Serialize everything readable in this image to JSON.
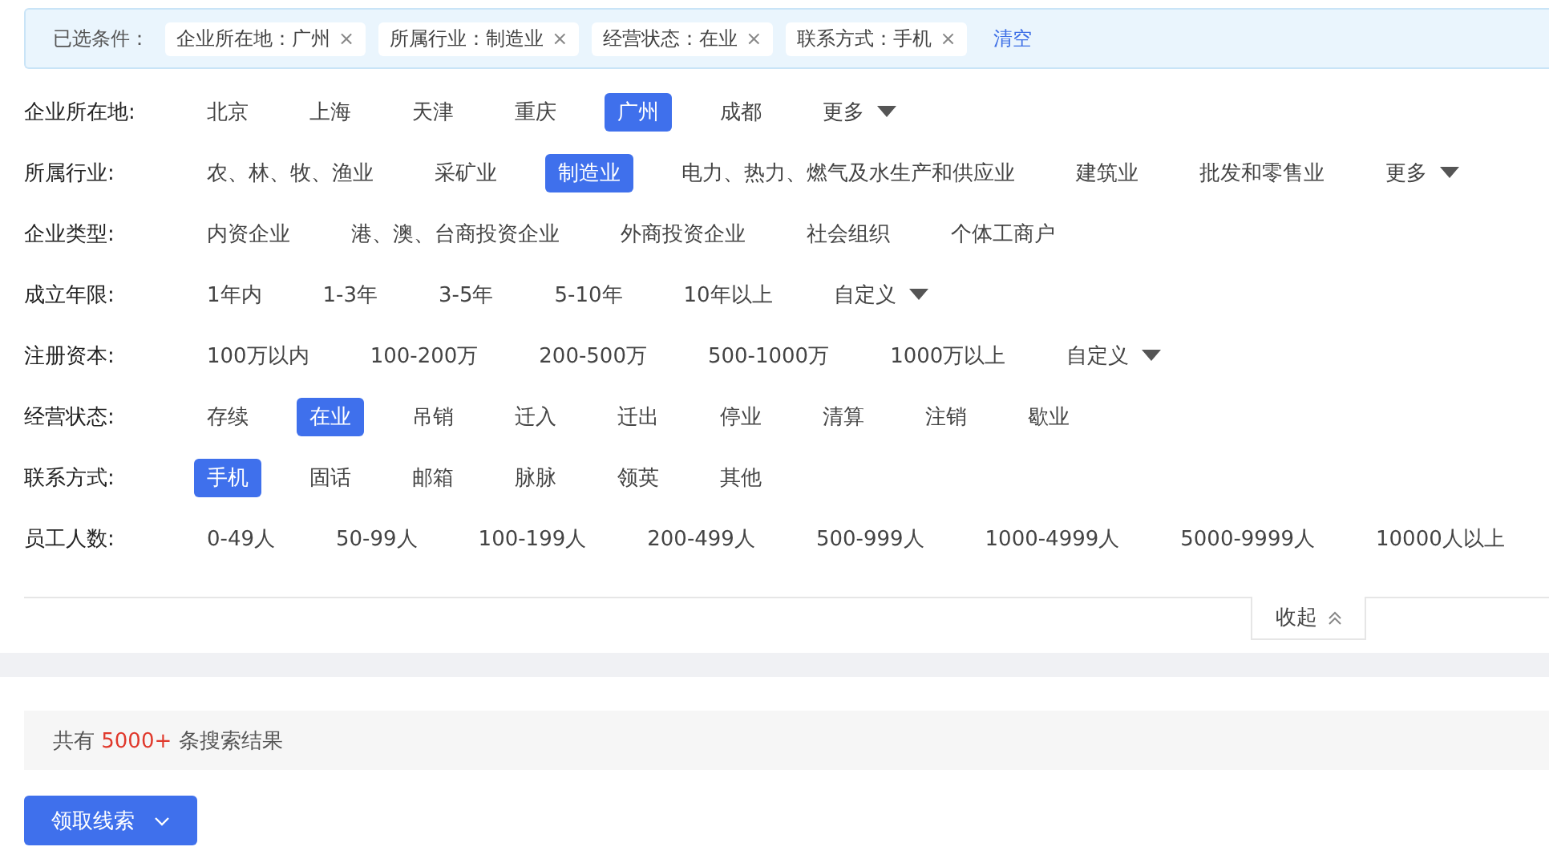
{
  "selected_conditions": {
    "label": "已选条件：",
    "tags": [
      {
        "text": "企业所在地：广州",
        "close": "×"
      },
      {
        "text": "所属行业：制造业",
        "close": "×"
      },
      {
        "text": "经营状态：在业",
        "close": "×"
      },
      {
        "text": "联系方式：手机",
        "close": "×"
      }
    ],
    "clear": "清空"
  },
  "filters": [
    {
      "label": "企业所在地:",
      "options": [
        {
          "kind": "option",
          "text": "北京",
          "selected": false
        },
        {
          "kind": "option",
          "text": "上海",
          "selected": false
        },
        {
          "kind": "option",
          "text": "天津",
          "selected": false
        },
        {
          "kind": "option",
          "text": "重庆",
          "selected": false
        },
        {
          "kind": "option",
          "text": "广州",
          "selected": true
        },
        {
          "kind": "option",
          "text": "成都",
          "selected": false
        },
        {
          "kind": "dropdown",
          "text": "更多",
          "selected": false
        }
      ]
    },
    {
      "label": "所属行业:",
      "options": [
        {
          "kind": "option",
          "text": "农、林、牧、渔业",
          "selected": false
        },
        {
          "kind": "option",
          "text": "采矿业",
          "selected": false
        },
        {
          "kind": "option",
          "text": "制造业",
          "selected": true
        },
        {
          "kind": "option",
          "text": "电力、热力、燃气及水生产和供应业",
          "selected": false
        },
        {
          "kind": "option",
          "text": "建筑业",
          "selected": false
        },
        {
          "kind": "option",
          "text": "批发和零售业",
          "selected": false
        },
        {
          "kind": "dropdown",
          "text": "更多",
          "selected": false
        }
      ]
    },
    {
      "label": "企业类型:",
      "options": [
        {
          "kind": "option",
          "text": "内资企业",
          "selected": false
        },
        {
          "kind": "option",
          "text": "港、澳、台商投资企业",
          "selected": false
        },
        {
          "kind": "option",
          "text": "外商投资企业",
          "selected": false
        },
        {
          "kind": "option",
          "text": "社会组织",
          "selected": false
        },
        {
          "kind": "option",
          "text": "个体工商户",
          "selected": false
        }
      ]
    },
    {
      "label": "成立年限:",
      "options": [
        {
          "kind": "option",
          "text": "1年内",
          "selected": false
        },
        {
          "kind": "option",
          "text": "1-3年",
          "selected": false
        },
        {
          "kind": "option",
          "text": "3-5年",
          "selected": false
        },
        {
          "kind": "option",
          "text": "5-10年",
          "selected": false
        },
        {
          "kind": "option",
          "text": "10年以上",
          "selected": false
        },
        {
          "kind": "dropdown",
          "text": "自定义",
          "selected": false
        }
      ]
    },
    {
      "label": "注册资本:",
      "options": [
        {
          "kind": "option",
          "text": "100万以内",
          "selected": false
        },
        {
          "kind": "option",
          "text": "100-200万",
          "selected": false
        },
        {
          "kind": "option",
          "text": "200-500万",
          "selected": false
        },
        {
          "kind": "option",
          "text": "500-1000万",
          "selected": false
        },
        {
          "kind": "option",
          "text": "1000万以上",
          "selected": false
        },
        {
          "kind": "dropdown",
          "text": "自定义",
          "selected": false
        }
      ]
    },
    {
      "label": "经营状态:",
      "options": [
        {
          "kind": "option",
          "text": "存续",
          "selected": false
        },
        {
          "kind": "option",
          "text": "在业",
          "selected": true
        },
        {
          "kind": "option",
          "text": "吊销",
          "selected": false
        },
        {
          "kind": "option",
          "text": "迁入",
          "selected": false
        },
        {
          "kind": "option",
          "text": "迁出",
          "selected": false
        },
        {
          "kind": "option",
          "text": "停业",
          "selected": false
        },
        {
          "kind": "option",
          "text": "清算",
          "selected": false
        },
        {
          "kind": "option",
          "text": "注销",
          "selected": false
        },
        {
          "kind": "option",
          "text": "歇业",
          "selected": false
        }
      ]
    },
    {
      "label": "联系方式:",
      "options": [
        {
          "kind": "option",
          "text": "手机",
          "selected": true
        },
        {
          "kind": "option",
          "text": "固话",
          "selected": false
        },
        {
          "kind": "option",
          "text": "邮箱",
          "selected": false
        },
        {
          "kind": "option",
          "text": "脉脉",
          "selected": false
        },
        {
          "kind": "option",
          "text": "领英",
          "selected": false
        },
        {
          "kind": "option",
          "text": "其他",
          "selected": false
        }
      ]
    },
    {
      "label": "员工人数:",
      "options": [
        {
          "kind": "option",
          "text": "0-49人",
          "selected": false
        },
        {
          "kind": "option",
          "text": "50-99人",
          "selected": false
        },
        {
          "kind": "option",
          "text": "100-199人",
          "selected": false
        },
        {
          "kind": "option",
          "text": "200-499人",
          "selected": false
        },
        {
          "kind": "option",
          "text": "500-999人",
          "selected": false
        },
        {
          "kind": "option",
          "text": "1000-4999人",
          "selected": false
        },
        {
          "kind": "option",
          "text": "5000-9999人",
          "selected": false
        },
        {
          "kind": "option",
          "text": "10000人以上",
          "selected": false
        }
      ]
    }
  ],
  "collapse_button": "收起",
  "results": {
    "prefix": "共有",
    "count": "5000+",
    "suffix": "条搜索结果"
  },
  "claim_button": "领取线索"
}
